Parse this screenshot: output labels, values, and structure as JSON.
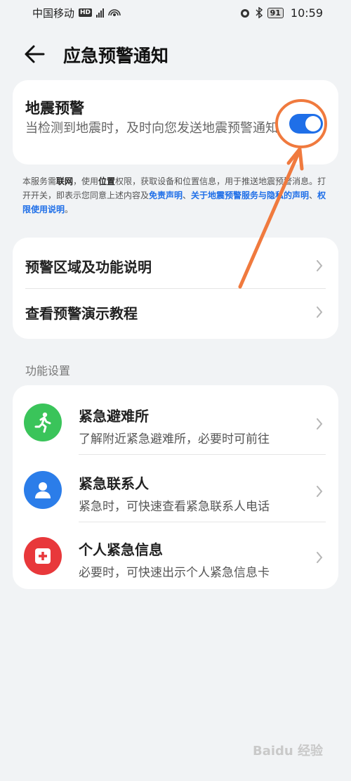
{
  "status_bar": {
    "carrier": "中国移动",
    "hd": "HD",
    "battery": "91",
    "time": "10:59"
  },
  "header": {
    "title": "应急预警通知"
  },
  "quake": {
    "title": "地震预警",
    "description": "当检测到地震时，及时向您发送地震预警通知",
    "toggle_on": true
  },
  "notice": {
    "p1": "本服务需",
    "network": "联网",
    "p2": "，使用",
    "location": "位置",
    "p3": "权限，获取设备和位置信息，用于推送地震预警消息。打开开关，即表示您同意上述内容及",
    "link1": "免责声明",
    "sep1": "、",
    "link2": "关于地震预警服务与隐私的声明",
    "sep2": "、",
    "link3": "权限使用说明",
    "end": "。"
  },
  "info_rows": [
    {
      "label": "预警区域及功能说明"
    },
    {
      "label": "查看预警演示教程"
    }
  ],
  "section_label": "功能设置",
  "features": [
    {
      "title": "紧急避难所",
      "desc": "了解附近紧急避难所，必要时可前往",
      "color": "#3ac45a",
      "icon": "running-person-icon"
    },
    {
      "title": "紧急联系人",
      "desc": "紧急时，可快速查看紧急联系人电话",
      "color": "#2b7de9",
      "icon": "person-icon"
    },
    {
      "title": "个人紧急信息",
      "desc": "必要时，可快速出示个人紧急信息卡",
      "color": "#e8383b",
      "icon": "medical-cross-icon"
    }
  ],
  "colors": {
    "accent": "#1f6fe8",
    "annotation": "#f07a3e"
  },
  "watermark": "Baidu 经验"
}
